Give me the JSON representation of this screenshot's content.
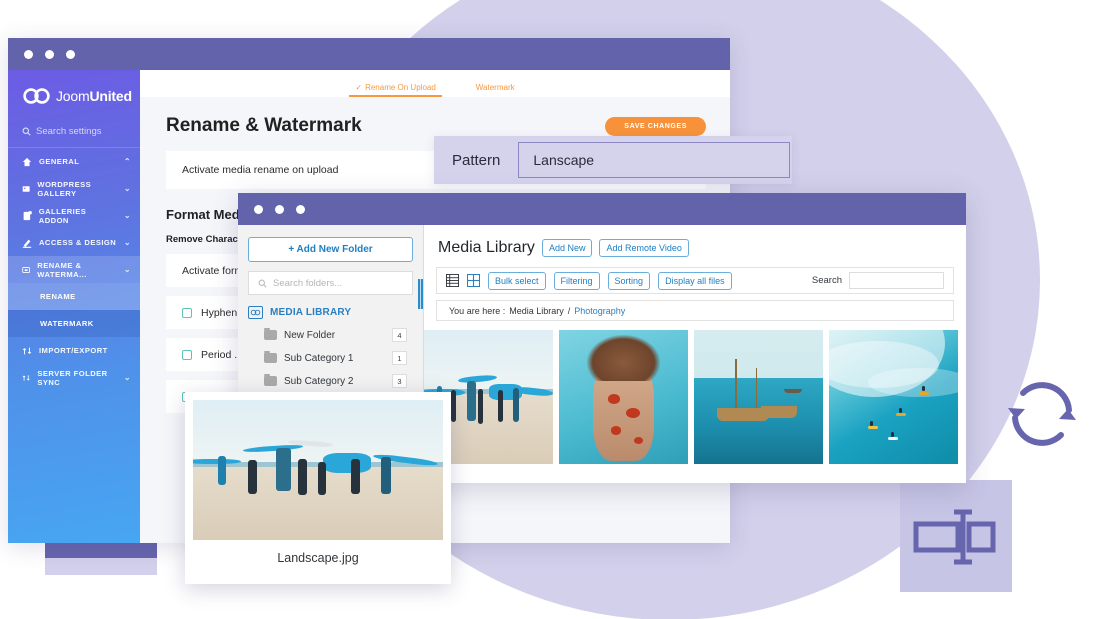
{
  "background": {
    "circle_color": "#d2d0ea",
    "accent_purple": "#6665ad",
    "square_left_icon": "copy-duplicate-icon",
    "square_right_icon": "rename-resize-icon",
    "floating_icon": "sync-refresh-icon"
  },
  "settings_window": {
    "titlebar_dots": 3,
    "sidebar": {
      "logo_text_1": "Joom",
      "logo_text_2": "United",
      "search_placeholder": "Search settings",
      "items": [
        {
          "label": "GENERAL",
          "icon": "home-icon",
          "chevron": "⌃",
          "state": "expanded"
        },
        {
          "label": "WORDPRESS GALLERY",
          "icon": "image-icon",
          "chevron": "⌄",
          "state": "collapsed"
        },
        {
          "label": "GALLERIES ADDON",
          "icon": "addon-icon",
          "chevron": "⌄",
          "state": "collapsed"
        },
        {
          "label": "ACCESS & DESIGN",
          "icon": "brush-icon",
          "chevron": "⌄",
          "state": "collapsed"
        },
        {
          "label": "RENAME & WATERMA...",
          "icon": "rename-icon",
          "chevron": "⌄",
          "state": "active"
        }
      ],
      "sub_items": [
        {
          "label": "RENAME",
          "state": "selected"
        },
        {
          "label": "WATERMARK",
          "state": "normal"
        }
      ],
      "items_bottom": [
        {
          "label": "IMPORT/EXPORT",
          "icon": "transfer-icon",
          "chevron": ""
        },
        {
          "label": "SERVER FOLDER SYNC",
          "icon": "transfer-icon",
          "chevron": "⌄"
        }
      ]
    },
    "tabs": [
      {
        "label": "Rename On Upload",
        "active": true,
        "check": "✓"
      },
      {
        "label": "Watermark",
        "active": false,
        "check": ""
      }
    ],
    "page_title": "Rename & Watermark",
    "save_label": "SAVE CHANGES",
    "activate_row_label": "Activate media rename on upload",
    "toggle_state": "on",
    "toggle_color": "#2fcc71",
    "section_title": "Format Media",
    "sub_section_title": "Remove Characters",
    "activate_format_label": "Activate format",
    "checkbox_rows": [
      {
        "label": "Hyphen -",
        "checked": false
      },
      {
        "label": "Period .",
        "checked": false
      },
      {
        "label": "",
        "checked": false
      }
    ]
  },
  "pattern_panel": {
    "label": "Pattern",
    "value": "Lanscape"
  },
  "media_window": {
    "titlebar_dots": 3,
    "folder_pane": {
      "add_folder_label": "+  Add New Folder",
      "search_placeholder": "Search folders...",
      "root_label": "MEDIA LIBRARY",
      "root_icon": "joomunited-logo-icon",
      "folders": [
        {
          "name": "New Folder",
          "count": "4"
        },
        {
          "name": "Sub Category 1",
          "count": "1"
        },
        {
          "name": "Sub Category 2",
          "count": "3"
        }
      ]
    },
    "header": {
      "title": "Media Library",
      "buttons": [
        "Add New",
        "Add Remote Video"
      ]
    },
    "toolbar": {
      "view_list_icon": "list-view-icon",
      "view_grid_icon": "grid-view-icon",
      "buttons": [
        "Bulk select",
        "Filtering",
        "Sorting",
        "Display all files"
      ],
      "search_label": "Search",
      "search_value": ""
    },
    "breadcrumb": {
      "prefix": "You are here :",
      "root": "Media Library",
      "separator": "/",
      "current": "Photography"
    },
    "thumbnails": [
      {
        "alt": "surfers-carrying-boards-on-beach"
      },
      {
        "alt": "woman-underwater-in-red-print-dress"
      },
      {
        "alt": "wooden-boat-on-turquoise-sea"
      },
      {
        "alt": "aerial-surfers-riding-a-big-wave"
      }
    ]
  },
  "preview_card": {
    "filename": "Landscape.jpg",
    "image_alt": "surfers-carrying-boards-on-beach"
  }
}
